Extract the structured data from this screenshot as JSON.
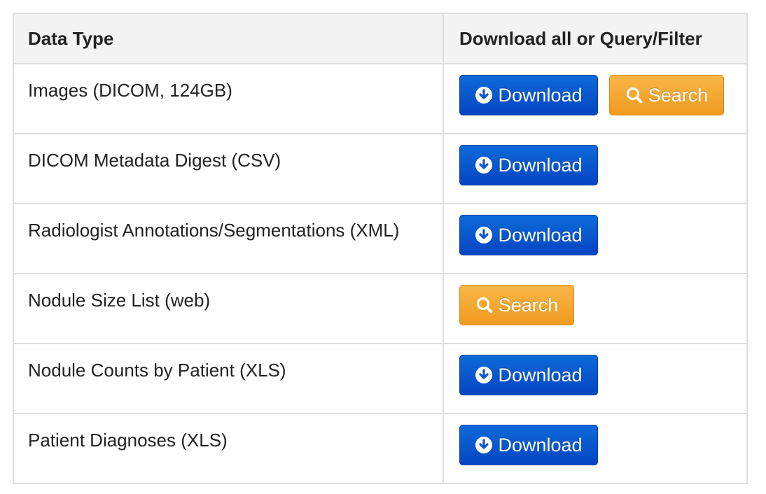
{
  "header": {
    "col1": "Data Type",
    "col2": "Download all or Query/Filter"
  },
  "rows": [
    {
      "label": "Images (DICOM, 124GB)",
      "download": "Download",
      "search": "Search"
    },
    {
      "label": "DICOM Metadata Digest (CSV)",
      "download": "Download"
    },
    {
      "label": "Radiologist Annotations/Segmentations (XML)",
      "download": "Download"
    },
    {
      "label": "Nodule Size List (web)",
      "search": "Search"
    },
    {
      "label": "Nodule Counts by Patient (XLS)",
      "download": "Download"
    },
    {
      "label": "Patient Diagnoses (XLS)",
      "download": "Download"
    }
  ],
  "icons": {
    "download": "download-circle-icon",
    "search": "search-icon"
  },
  "colors": {
    "download_button": "#0a56cf",
    "search_button": "#f5a833",
    "header_bg": "#f3f3f3",
    "border": "#dedede"
  }
}
